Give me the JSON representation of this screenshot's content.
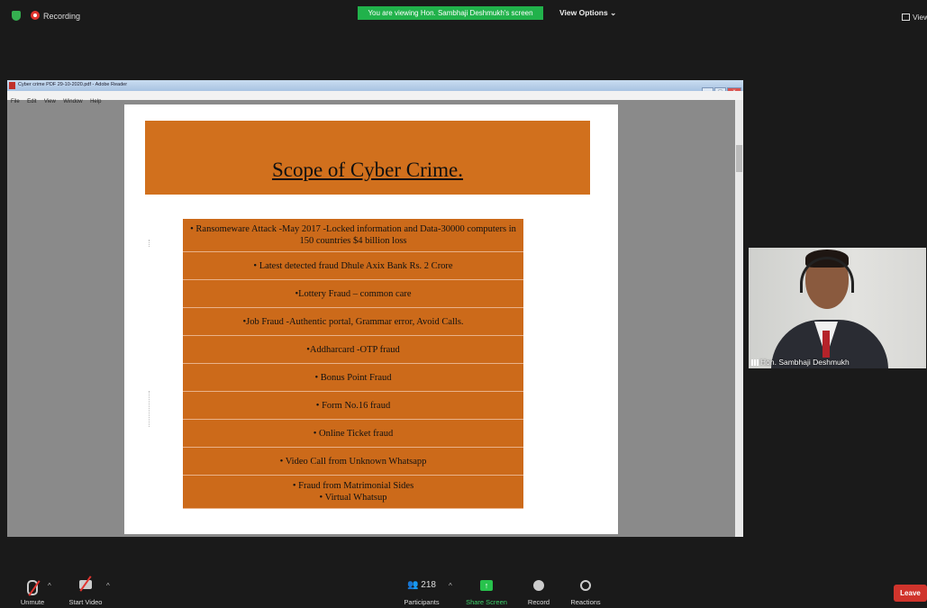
{
  "topbar": {
    "recording_label": "Recording",
    "viewing_banner": "You are viewing Hon. Sambhaji Deshmukh's screen",
    "view_options": "View Options",
    "view_right": "View"
  },
  "reader": {
    "title": "Cyber crime PDF 29-10-2020.pdf - Adobe Reader",
    "menu": [
      "File",
      "Edit",
      "View",
      "Window",
      "Help"
    ],
    "doc_close": "×"
  },
  "slide": {
    "title": "Scope of Cyber Crime.",
    "bullets": [
      "• Ransomeware Attack -May 2017 -Locked information and Data-30000 computers in 150 countries $4 billion loss",
      "• Latest detected fraud Dhule Axix Bank Rs. 2 Crore",
      "•Lottery Fraud – common care",
      "•Job Fraud -Authentic portal, Grammar error, Avoid Calls.",
      "•Addharcard -OTP fraud",
      "• Bonus Point Fraud",
      "• Form No.16 fraud",
      "• Online Ticket fraud",
      "• Video Call from Unknown Whatsapp",
      "• Fraud from Matrimonial Sides",
      "• Virtual Whatsup"
    ]
  },
  "video": {
    "name": "Hon. Sambhaji Deshmukh"
  },
  "toolbar": {
    "unmute": "Unmute",
    "start_video": "Start Video",
    "participants": "Participants",
    "participants_count": "218",
    "share_screen": "Share Screen",
    "record": "Record",
    "reactions": "Reactions",
    "leave": "Leave"
  },
  "colors": {
    "banner": "#21b24b",
    "slide_orange": "#cc6a1a",
    "leave": "#d0342c"
  }
}
